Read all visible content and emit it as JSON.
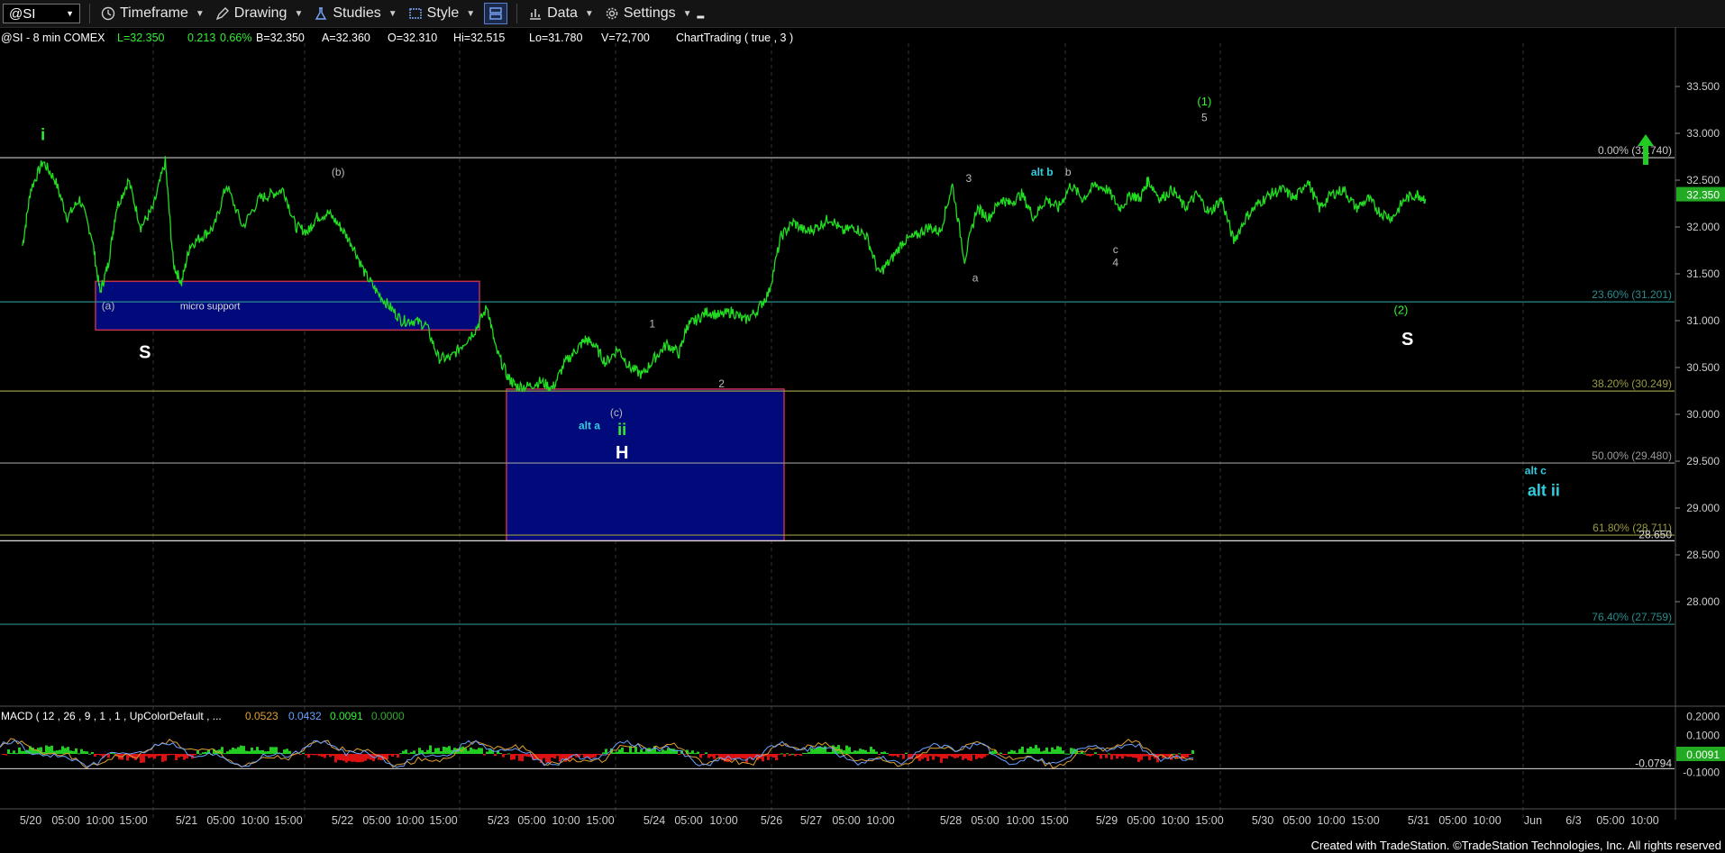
{
  "toolbar": {
    "symbol": "@SI",
    "timeframe_label": "Timeframe",
    "drawing_label": "Drawing",
    "studies_label": "Studies",
    "style_label": "Style",
    "data_label": "Data",
    "settings_label": "Settings"
  },
  "info_bar": {
    "symbol_line": "@SI - 8 min  COMEX",
    "last": "L=32.350",
    "change": "0.213",
    "change_pct": "0.66%",
    "bid": "B=32.350",
    "ask": "A=32.360",
    "open": "O=32.310",
    "high": "Hi=32.515",
    "low": "Lo=31.780",
    "volume": "V=72,700",
    "strategy": "ChartTrading ( true , 3 )"
  },
  "macd_header": {
    "title": "MACD ( 12 , 26 , 9 , 1 , 1 , UpColorDefault , ...",
    "v1": "0.0523",
    "v2": "0.0432",
    "v3": "0.0091",
    "v4": "0.0000"
  },
  "footer_text": "Created with TradeStation. ©TradeStation Technologies, Inc. All rights reserved",
  "colors": {
    "price_line": "#22dd22",
    "box_fill": "#000a7a",
    "box_border": "#c0304a",
    "label_green": "#33ee33",
    "label_cyan": "#33ccdd",
    "last_price_bg": "#22aa22",
    "grid": "#3a3a3a"
  },
  "chart_data": {
    "type": "line",
    "title": "",
    "price_axis": {
      "ticks": [
        33.5,
        33.0,
        32.5,
        32.0,
        31.5,
        31.0,
        30.5,
        30.0,
        29.5,
        29.0,
        28.5,
        28.0
      ],
      "tick_labels": [
        "33.500",
        "33.000",
        "32.500",
        "32.000",
        "31.500",
        "31.000",
        "30.500",
        "30.000",
        "29.500",
        "29.000",
        "28.500",
        "28.000"
      ],
      "last_price_label": "32.350",
      "side_label": "28.650"
    },
    "macd_axis": {
      "ticks": [
        0.2,
        0.1,
        -0.1
      ],
      "tick_labels": [
        "0.2000",
        "0.1000",
        "-0.1000"
      ],
      "last_value_label": "0.0091",
      "line_label": "-0.0794",
      "line_value": -0.0794
    },
    "time_axis_labels": [
      "5/20",
      "05:00",
      "10:00",
      "15:00",
      "5/21",
      "05:00",
      "10:00",
      "15:00",
      "5/22",
      "05:00",
      "10:00",
      "15:00",
      "5/23",
      "05:00",
      "10:00",
      "15:00",
      "5/24",
      "05:00",
      "10:00",
      "5/26",
      "5/27",
      "05:00",
      "10:00",
      "5/28",
      "05:00",
      "10:00",
      "15:00",
      "5/29",
      "05:00",
      "10:00",
      "15:00",
      "5/30",
      "05:00",
      "10:00",
      "15:00",
      "5/31",
      "05:00",
      "10:00",
      "Jun",
      "6/3",
      "05:00",
      "10:00"
    ],
    "fib_levels": [
      {
        "label": "0.00% (32.740)",
        "price": 32.74,
        "color": "#c8c8c8"
      },
      {
        "label": "23.60% (31.201)",
        "price": 31.201,
        "color": "#2a8c8c"
      },
      {
        "label": "38.20% (30.249)",
        "price": 30.249,
        "color": "#9a9a40"
      },
      {
        "label": "50.00% (29.480)",
        "price": 29.48,
        "color": "#9a9a9a"
      },
      {
        "label": "61.80% (28.711)",
        "price": 28.711,
        "color": "#9a9a40"
      },
      {
        "label": "76.40% (27.759)",
        "price": 27.759,
        "color": "#2a8c8c"
      }
    ],
    "support_line": {
      "price": 28.65
    },
    "zones": [
      {
        "label": "micro support",
        "price_top": 31.42,
        "price_bottom": 30.9,
        "t_start": 0.85,
        "t_end": 6.85
      },
      {
        "label": "",
        "price_top": 30.27,
        "price_bottom": 28.65,
        "t_start": 7.15,
        "t_end": 10.65
      }
    ],
    "price_series": {
      "x": [
        0,
        0.1,
        0.25,
        0.4,
        0.55,
        0.7,
        0.85,
        0.95,
        1.05,
        1.15,
        1.3,
        1.45,
        1.6,
        1.75,
        1.85,
        1.95,
        2.05,
        2.2,
        2.35,
        2.5,
        2.7,
        2.9,
        3.05,
        3.2,
        3.35,
        3.5,
        3.6,
        3.75,
        3.9,
        4.05,
        4.2,
        4.35,
        4.5,
        4.65,
        4.8,
        4.95,
        5.1,
        5.25,
        5.4,
        5.55,
        5.7,
        5.8,
        5.95,
        6.05,
        6.2,
        6.35,
        6.5,
        6.65,
        6.8,
        6.9,
        7.0,
        7.15,
        7.3,
        7.45,
        7.6,
        7.75,
        7.9,
        8.05,
        8.15,
        8.25,
        8.4,
        8.55,
        8.7,
        8.85,
        9.0,
        9.15,
        9.3,
        9.45,
        9.6,
        9.75,
        9.9,
        10.05,
        10.2,
        10.35,
        10.5,
        10.65,
        10.8,
        10.95,
        11.1,
        11.25,
        11.4,
        11.55,
        11.7,
        11.85,
        12.0,
        12.1,
        12.25,
        12.4,
        12.55,
        12.7,
        12.85,
        13.0,
        13.15,
        13.3,
        13.45,
        13.6,
        13.7,
        13.8,
        13.95,
        14.1,
        14.25,
        14.4,
        14.55,
        14.7,
        14.85,
        15.0,
        15.15,
        15.3,
        15.45,
        15.6,
        15.75,
        15.9,
        16.05,
        16.2,
        16.35,
        16.5,
        16.65,
        16.8,
        16.95,
        17.1,
        17.2
      ],
      "y": [
        31.8,
        32.4,
        32.7,
        32.5,
        32.1,
        32.3,
        31.9,
        31.3,
        31.6,
        32.2,
        32.5,
        32.0,
        32.2,
        32.7,
        31.6,
        31.4,
        31.8,
        31.9,
        32.0,
        32.45,
        32.0,
        32.3,
        32.35,
        32.4,
        32.0,
        31.95,
        32.1,
        32.15,
        32.0,
        31.8,
        31.5,
        31.3,
        31.15,
        31.0,
        31.0,
        30.95,
        30.6,
        30.6,
        30.75,
        30.9,
        31.15,
        30.7,
        30.4,
        30.3,
        30.3,
        30.35,
        30.28,
        30.55,
        30.7,
        30.8,
        30.75,
        30.55,
        30.7,
        30.5,
        30.42,
        30.6,
        30.75,
        30.65,
        30.95,
        31.0,
        31.1,
        31.05,
        31.1,
        31.0,
        31.1,
        31.3,
        31.9,
        32.05,
        31.95,
        32.0,
        32.1,
        31.95,
        32.0,
        31.9,
        31.5,
        31.65,
        31.85,
        31.9,
        32.0,
        31.95,
        32.45,
        31.65,
        32.2,
        32.1,
        32.3,
        32.25,
        32.35,
        32.1,
        32.3,
        32.2,
        32.45,
        32.3,
        32.45,
        32.4,
        32.2,
        32.35,
        32.3,
        32.5,
        32.3,
        32.4,
        32.2,
        32.35,
        32.15,
        32.3,
        31.85,
        32.1,
        32.25,
        32.35,
        32.4,
        32.3,
        32.5,
        32.2,
        32.35,
        32.4,
        32.2,
        32.3,
        32.15,
        32.1,
        32.3,
        32.35,
        32.3
      ],
      "_note_x_units": "index of 5-hour session ticks"
    },
    "wave_labels": [
      {
        "text": "i",
        "color": "#33ee33",
        "size": 18,
        "bold": true,
        "t": 0.25,
        "price": 32.93
      },
      {
        "text": "(a)",
        "color": "#bbbbbb",
        "size": 12,
        "t": 1.05,
        "price": 31.12
      },
      {
        "text": "micro support",
        "color": "#dddddd",
        "size": 11,
        "t": 2.3,
        "price": 31.12
      },
      {
        "text": "S",
        "color": "#ffffff",
        "size": 20,
        "bold": true,
        "t": 1.5,
        "price": 30.6
      },
      {
        "text": "(b)",
        "color": "#bbbbbb",
        "size": 12,
        "t": 3.87,
        "price": 32.55
      },
      {
        "text": "1",
        "color": "#bbbbbb",
        "size": 12,
        "t": 7.72,
        "price": 30.93
      },
      {
        "text": "2",
        "color": "#bbbbbb",
        "size": 12,
        "t": 8.57,
        "price": 30.29
      },
      {
        "text": "(c)",
        "color": "#bbbbbb",
        "size": 12,
        "t": 7.28,
        "price": 29.98
      },
      {
        "text": "alt a",
        "color": "#33ccdd",
        "size": 12,
        "bold": true,
        "t": 6.95,
        "price": 29.84
      },
      {
        "text": "ii",
        "color": "#33ee33",
        "size": 18,
        "bold": true,
        "t": 7.35,
        "price": 29.78
      },
      {
        "text": "H",
        "color": "#ffffff",
        "size": 20,
        "bold": true,
        "t": 7.35,
        "price": 29.53
      },
      {
        "text": "3",
        "color": "#bbbbbb",
        "size": 12,
        "t": 11.6,
        "price": 32.48
      },
      {
        "text": "a",
        "color": "#bbbbbb",
        "size": 12,
        "t": 11.68,
        "price": 31.42
      },
      {
        "text": "alt b",
        "color": "#33ccdd",
        "size": 12,
        "bold": true,
        "t": 12.5,
        "price": 32.55
      },
      {
        "text": "b",
        "color": "#bbbbbb",
        "size": 12,
        "t": 12.82,
        "price": 32.55
      },
      {
        "text": "c",
        "color": "#bbbbbb",
        "size": 12,
        "t": 13.4,
        "price": 31.72
      },
      {
        "text": "4",
        "color": "#bbbbbb",
        "size": 12,
        "t": 13.4,
        "price": 31.58
      },
      {
        "text": "(1)",
        "color": "#33ee33",
        "size": 13,
        "t": 14.49,
        "price": 33.3
      },
      {
        "text": "5",
        "color": "#bbbbbb",
        "size": 12,
        "t": 14.49,
        "price": 33.13
      },
      {
        "text": "(2)",
        "color": "#33ee33",
        "size": 13,
        "t": 16.9,
        "price": 31.07
      },
      {
        "text": "S",
        "color": "#ffffff",
        "size": 20,
        "bold": true,
        "t": 16.98,
        "price": 30.74
      },
      {
        "text": "alt c",
        "color": "#33ccdd",
        "size": 12,
        "bold": true,
        "t": 18.55,
        "price": 29.36
      },
      {
        "text": "alt ii",
        "color": "#33ccdd",
        "size": 18,
        "bold": true,
        "t": 18.65,
        "price": 29.13
      }
    ]
  }
}
